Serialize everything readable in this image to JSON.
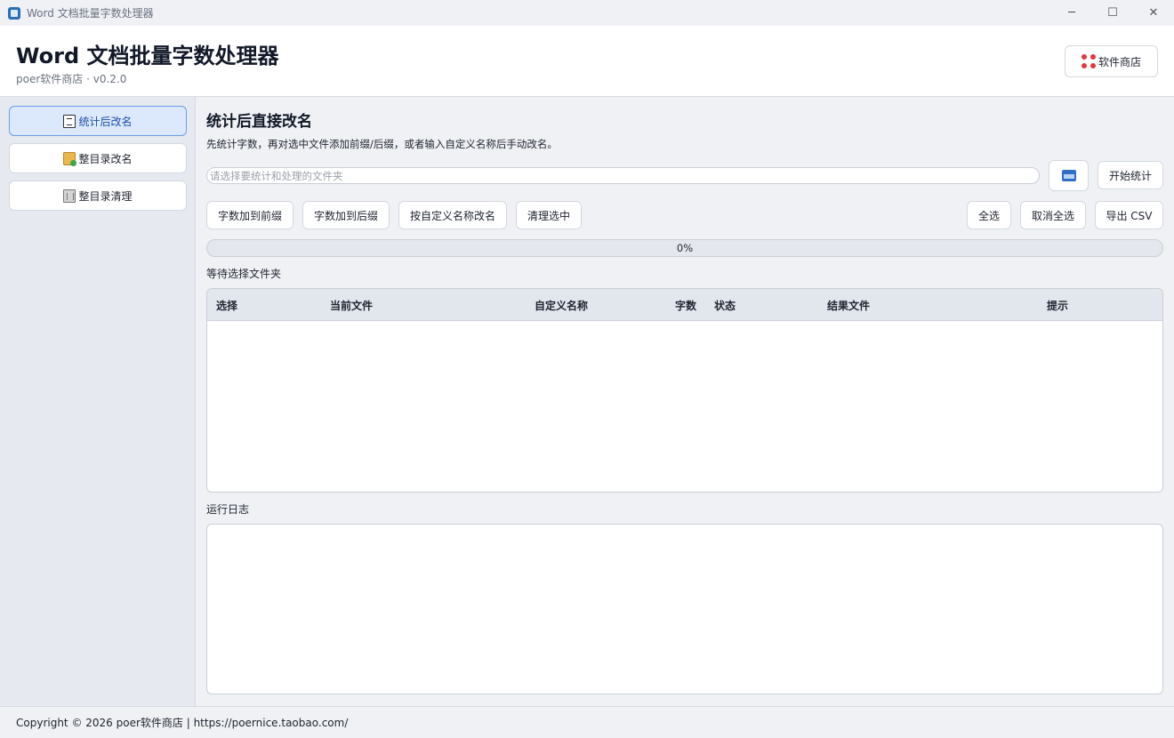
{
  "window": {
    "title": "Word 文档批量字数处理器",
    "minimize_glyph": "─",
    "maximize_glyph": "☐",
    "close_glyph": "✕"
  },
  "header": {
    "title": "Word 文档批量字数处理器",
    "subtitle": "poer软件商店 · v0.2.0",
    "store_label": "软件商店"
  },
  "sidebar": {
    "items": [
      {
        "label": "统计后改名",
        "icon": "document-icon",
        "active": true
      },
      {
        "label": "整目录改名",
        "icon": "folder-icon",
        "active": false
      },
      {
        "label": "整目录清理",
        "icon": "trash-icon",
        "active": false
      }
    ]
  },
  "main": {
    "title": "统计后直接改名",
    "description": "先统计字数，再对选中文件添加前缀/后缀，或者输入自定义名称后手动改名。",
    "path_placeholder": "请选择要统计和处理的文件夹",
    "path_value": "",
    "start_label": "开始统计",
    "actions": {
      "prefix_label": "字数加到前缀",
      "suffix_label": "字数加到后缀",
      "custom_label": "按自定义名称改名",
      "clean_label": "清理选中",
      "select_all_label": "全选",
      "deselect_all_label": "取消全选",
      "export_label": "导出 CSV"
    },
    "progress": {
      "value": 0,
      "text": "0%"
    },
    "status": "等待选择文件夹",
    "table": {
      "columns": [
        "选择",
        "当前文件",
        "自定义名称",
        "字数",
        "状态",
        "结果文件",
        "提示"
      ],
      "rows": []
    },
    "log_label": "运行日志",
    "log_text": ""
  },
  "footer": {
    "text": "Copyright © 2026 poer软件商店 | https://poernice.taobao.com/"
  },
  "colors": {
    "accent": "#4a86dd",
    "active_nav_bg": "#dce8fb",
    "active_nav_border": "#6b9ee8",
    "store_icon": "#e0393e"
  }
}
